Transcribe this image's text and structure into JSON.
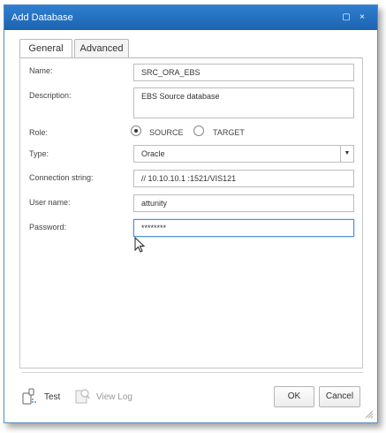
{
  "window": {
    "title": "Add Database",
    "restore_glyph": "▢",
    "close_glyph": "×"
  },
  "tabs": [
    {
      "label": "General",
      "active": true
    },
    {
      "label": "Advanced",
      "active": false
    }
  ],
  "form": {
    "name_label": "Name:",
    "name_value": "SRC_ORA_EBS",
    "description_label": "Description:",
    "description_value": "EBS Source database",
    "role_label": "Role:",
    "role_options": [
      "SOURCE",
      "TARGET"
    ],
    "role_selected": "SOURCE",
    "type_label": "Type:",
    "type_value": "Oracle",
    "connection_label": "Connection string:",
    "connection_value": "// 10.10.10.1  :1521/VIS121",
    "username_label": "User name:",
    "username_value": "attunity",
    "password_label": "Password:",
    "password_value": "********"
  },
  "footer": {
    "test_label": "Test",
    "viewlog_label": "View Log",
    "ok_label": "OK",
    "cancel_label": "Cancel"
  },
  "colors": {
    "titlebar": "#2a78c8",
    "focus_border": "#4a90d9"
  },
  "icons": [
    "restore-icon",
    "close-icon",
    "radio-selected-icon",
    "radio-unselected-icon",
    "dropdown-arrow-icon",
    "test-connection-icon",
    "view-log-icon",
    "resize-grip-icon",
    "mouse-cursor-icon"
  ]
}
